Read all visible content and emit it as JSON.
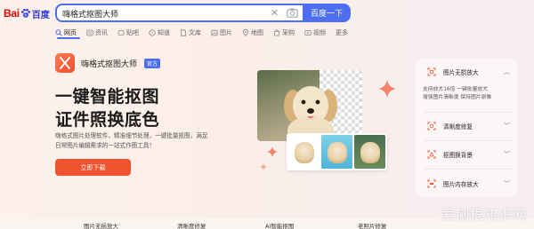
{
  "header": {
    "logo_text": "Bai",
    "logo_du": "百度",
    "search_query": "嗨格式抠图大师",
    "search_button": "百度一下",
    "clear_glyph": "✕"
  },
  "tabs": [
    {
      "label": "网页",
      "icon": "search-icon",
      "active": true
    },
    {
      "label": "资讯",
      "icon": "news-icon"
    },
    {
      "label": "贴吧",
      "icon": "tieba-icon"
    },
    {
      "label": "知道",
      "icon": "question-icon"
    },
    {
      "label": "文库",
      "icon": "doc-icon"
    },
    {
      "label": "图片",
      "icon": "image-icon"
    },
    {
      "label": "地图",
      "icon": "map-icon"
    },
    {
      "label": "采购",
      "icon": "shop-icon"
    },
    {
      "label": "视频",
      "icon": "video-icon"
    },
    {
      "label": "更多",
      "icon": ""
    }
  ],
  "app": {
    "name": "嗨格式抠图大师",
    "badge": "官方",
    "headline_1": "一键智能抠图",
    "headline_2": "证件照换底色",
    "desc_1": "嗨格式图片处理软件，精准细节处理，一键批量抠图，满足",
    "desc_2": "日常图片编辑需求的一站式作图工具！",
    "download_button": "立即下载"
  },
  "sidebar": {
    "items": [
      {
        "label": "图片无损放大",
        "chevron": "︿",
        "desc_1": "支持放大16倍  一键批量放大",
        "desc_2": "增强图片清晰度  保持图片原像"
      },
      {
        "label": "清晰度修复",
        "chevron": "﹀"
      },
      {
        "label": "抠图换背景",
        "chevron": "﹀"
      },
      {
        "label": "图片内存放大",
        "chevron": "﹀"
      }
    ]
  },
  "bottom": {
    "labels": [
      "图片无损放大",
      "清晰度修复",
      "AI智能抠图",
      "老照片修复"
    ]
  },
  "watermark": "爱刨根知识网",
  "colors": {
    "accent_blue": "#4e6ef2",
    "brand_red": "#e10601",
    "download_orange": "#f0532f"
  }
}
